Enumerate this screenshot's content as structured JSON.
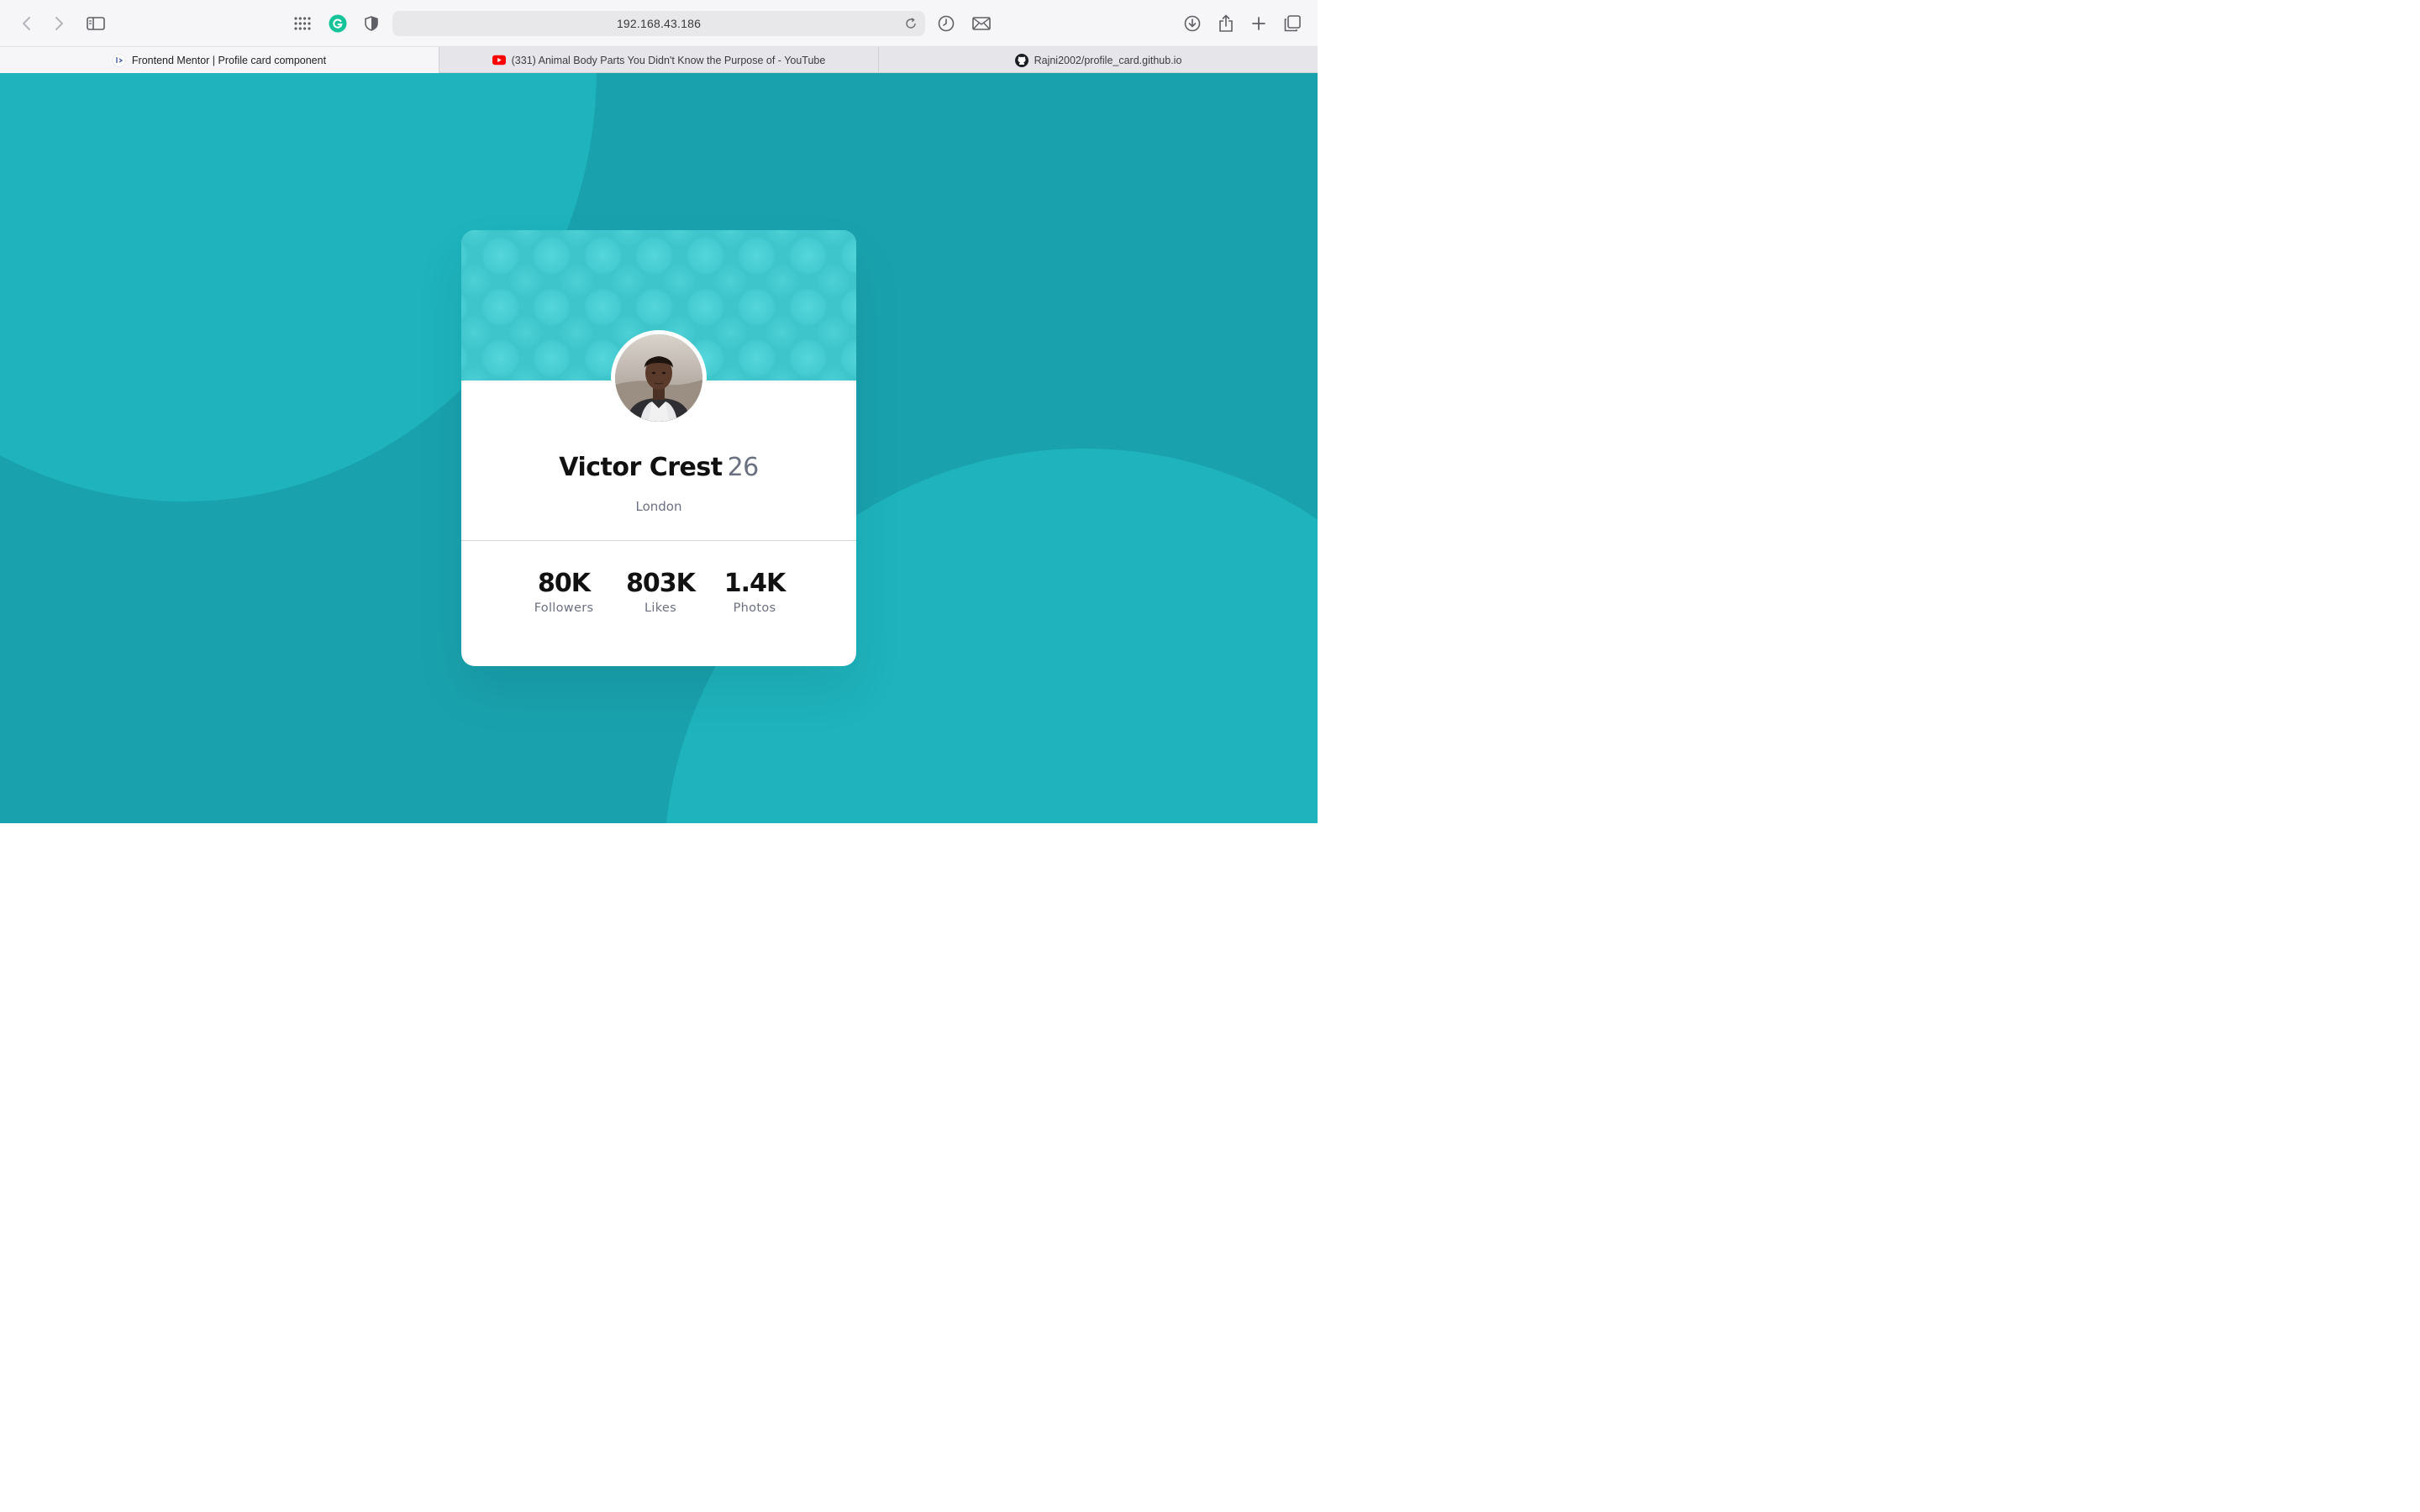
{
  "browser": {
    "url": "192.168.43.186",
    "tabs": [
      {
        "label": "Frontend Mentor | Profile card component",
        "favicon": "frontend-mentor-icon",
        "active": true
      },
      {
        "label": "(331) Animal Body Parts You Didn't Know the Purpose of - YouTube",
        "favicon": "youtube-icon",
        "active": false
      },
      {
        "label": "Rajni2002/profile_card.github.io",
        "favicon": "github-icon",
        "active": false
      }
    ],
    "icons": {
      "back": "chevron-left-icon",
      "forward": "chevron-right-icon",
      "sidebar": "sidebar-icon",
      "apps": "grid-icon",
      "grammarly": "grammarly-icon",
      "shield": "shield-icon",
      "reload": "reload-icon",
      "history": "clock-icon",
      "mail": "mail-icon",
      "download": "download-icon",
      "share": "share-icon",
      "new_tab": "plus-icon",
      "tab_overview": "tabs-overview-icon"
    }
  },
  "profile": {
    "name": "Victor Crest",
    "age": "26",
    "city": "London",
    "stats": [
      {
        "value": "80K",
        "label": "Followers"
      },
      {
        "value": "803K",
        "label": "Likes"
      },
      {
        "value": "1.4K",
        "label": "Photos"
      }
    ]
  },
  "colors": {
    "background": "#19a2ae",
    "blob": "#1eb3bd",
    "card_banner": "#3ec4cb",
    "text_dark": "#111111",
    "text_muted": "#6b7080"
  }
}
